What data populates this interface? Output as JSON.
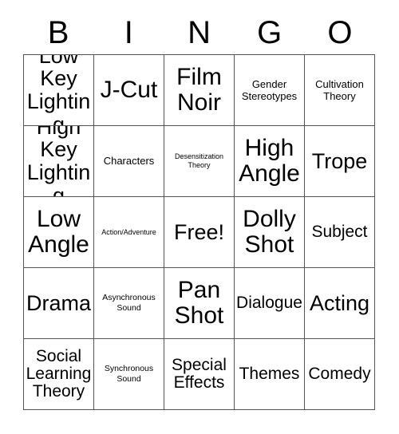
{
  "card": {
    "title": "BINGO",
    "header_letters": [
      "B",
      "I",
      "N",
      "G",
      "O"
    ],
    "free_space_label": "Free!",
    "rows": [
      [
        {
          "label": "Low Key Lighting",
          "size": "lg"
        },
        {
          "label": "J-Cut",
          "size": "xl"
        },
        {
          "label": "Film Noir",
          "size": "xl"
        },
        {
          "label": "Gender Stereotypes",
          "size": "sm"
        },
        {
          "label": "Cultivation Theory",
          "size": "sm"
        }
      ],
      [
        {
          "label": "High Key Lighting",
          "size": "lg"
        },
        {
          "label": "Characters",
          "size": "sm"
        },
        {
          "label": "Desensitization Theory",
          "size": "xxs"
        },
        {
          "label": "High Angle",
          "size": "xl"
        },
        {
          "label": "Trope",
          "size": "lg"
        }
      ],
      [
        {
          "label": "Low Angle",
          "size": "xl"
        },
        {
          "label": "Action/Adventure",
          "size": "xxs"
        },
        {
          "label": "Free!",
          "size": "lg"
        },
        {
          "label": "Dolly Shot",
          "size": "xl"
        },
        {
          "label": "Subject",
          "size": "md"
        }
      ],
      [
        {
          "label": "Drama",
          "size": "lg"
        },
        {
          "label": "Asynchronous Sound",
          "size": "xs"
        },
        {
          "label": "Pan Shot",
          "size": "xl"
        },
        {
          "label": "Dialogue",
          "size": "md"
        },
        {
          "label": "Acting",
          "size": "lg"
        }
      ],
      [
        {
          "label": "Social Learning Theory",
          "size": "md"
        },
        {
          "label": "Synchronous Sound",
          "size": "xs"
        },
        {
          "label": "Special Effects",
          "size": "md"
        },
        {
          "label": "Themes",
          "size": "md"
        },
        {
          "label": "Comedy",
          "size": "md"
        }
      ]
    ]
  },
  "colors": {
    "background": "#ffffff",
    "text": "#000000",
    "grid_line": "#555555"
  }
}
